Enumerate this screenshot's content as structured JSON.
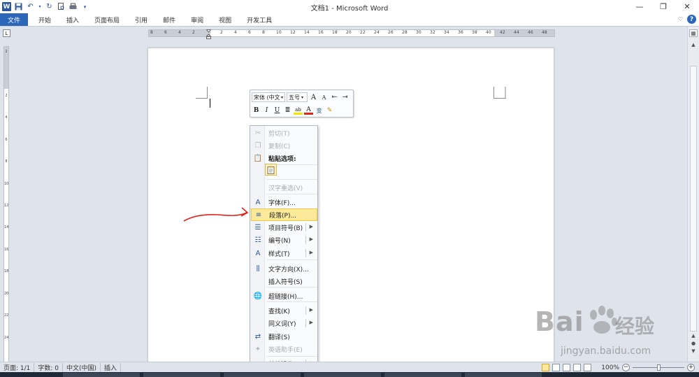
{
  "window": {
    "title": "文档1 - Microsoft Word",
    "controls": [
      "minimize",
      "restore",
      "close"
    ]
  },
  "quick_access": {
    "icons": [
      "word-logo",
      "save-icon",
      "undo-icon",
      "redo-icon",
      "print-preview-icon",
      "print-icon",
      "customize-icon"
    ]
  },
  "ribbon": {
    "tabs": [
      {
        "label": "文件",
        "active": true
      },
      {
        "label": "开始"
      },
      {
        "label": "插入"
      },
      {
        "label": "页面布局"
      },
      {
        "label": "引用"
      },
      {
        "label": "邮件"
      },
      {
        "label": "审阅"
      },
      {
        "label": "视图"
      },
      {
        "label": "开发工具"
      }
    ],
    "help": "?"
  },
  "ruler": {
    "tab_selector": "L",
    "h_numbers": [
      "8",
      "6",
      "4",
      "2",
      "",
      "2",
      "4",
      "6",
      "8",
      "10",
      "12",
      "14",
      "16",
      "18",
      "20",
      "22",
      "24",
      "26",
      "28",
      "30",
      "32",
      "34",
      "36",
      "38",
      "40",
      "42",
      "44",
      "46",
      "48"
    ],
    "v_numbers": [
      "2",
      "",
      "2",
      "4",
      "6",
      "8",
      "10",
      "12",
      "14",
      "16",
      "18",
      "20",
      "22",
      "24"
    ]
  },
  "mini_toolbar": {
    "font_name": "宋体 (中文",
    "font_size": "五号",
    "row1_icons": [
      "grow-font-icon",
      "shrink-font-icon",
      "decrease-indent-icon",
      "increase-indent-icon"
    ],
    "row1_glyphs": [
      "A",
      "A",
      "⇤",
      "⇥"
    ],
    "row2_buttons": [
      {
        "glyph": "B",
        "name": "bold-icon"
      },
      {
        "glyph": "I",
        "name": "italic-icon"
      },
      {
        "glyph": "U",
        "name": "underline-icon"
      },
      {
        "glyph": "≣",
        "name": "center-icon"
      },
      {
        "glyph": "ab",
        "name": "highlight-icon"
      },
      {
        "glyph": "A",
        "name": "font-color-icon"
      },
      {
        "glyph": "变",
        "name": "change-case-icon"
      },
      {
        "glyph": "✎",
        "name": "format-painter-icon"
      }
    ]
  },
  "context_menu": {
    "items": [
      {
        "label": "剪切(T)",
        "icon": "scissors-icon",
        "glyph": "✂",
        "disabled": true
      },
      {
        "label": "复制(C)",
        "icon": "copy-icon",
        "glyph": "❐",
        "disabled": true
      },
      {
        "label": "粘贴选项:",
        "icon": "paste-icon",
        "glyph": "📋",
        "header": true
      },
      {
        "label": "汉字重选(V)",
        "icon": "",
        "glyph": "",
        "disabled": true
      },
      {
        "label": "字体(F)...",
        "icon": "font-icon",
        "glyph": "A"
      },
      {
        "label": "段落(P)...",
        "icon": "paragraph-icon",
        "glyph": "≡",
        "highlight": true
      },
      {
        "label": "项目符号(B)",
        "icon": "bullets-icon",
        "glyph": "☰",
        "submenu": true
      },
      {
        "label": "编号(N)",
        "icon": "numbering-icon",
        "glyph": "☷",
        "submenu": true
      },
      {
        "label": "样式(T)",
        "icon": "styles-icon",
        "glyph": "A",
        "submenu": true
      },
      {
        "label": "文字方向(X)...",
        "icon": "text-direction-icon",
        "glyph": "⫼"
      },
      {
        "label": "插入符号(S)",
        "icon": "",
        "glyph": ""
      },
      {
        "label": "超链接(H)...",
        "icon": "hyperlink-icon",
        "glyph": "🌐"
      },
      {
        "label": "查找(K)",
        "icon": "",
        "glyph": "",
        "submenu": true
      },
      {
        "label": "同义词(Y)",
        "icon": "",
        "glyph": "",
        "submenu": true
      },
      {
        "label": "翻译(S)",
        "icon": "translate-icon",
        "glyph": "⇄"
      },
      {
        "label": "英语助手(E)",
        "icon": "english-assistant-icon",
        "glyph": "✦",
        "disabled": true
      },
      {
        "label": "其他操作(A)",
        "icon": "",
        "glyph": "",
        "submenu": true
      }
    ]
  },
  "statusbar": {
    "page": "页面: 1/1",
    "words": "字数: 0",
    "language": "中文(中国)",
    "mode": "插入",
    "zoom": "100%",
    "zoom_fraction": 0.5
  },
  "watermark": {
    "brand": "Bai",
    "brand_suffix": "经验",
    "url": "jingyan.baidu.com"
  },
  "colors": {
    "file_tab": "#2b66b8",
    "highlight": "#fde99a",
    "annotation": "#e0241b"
  }
}
